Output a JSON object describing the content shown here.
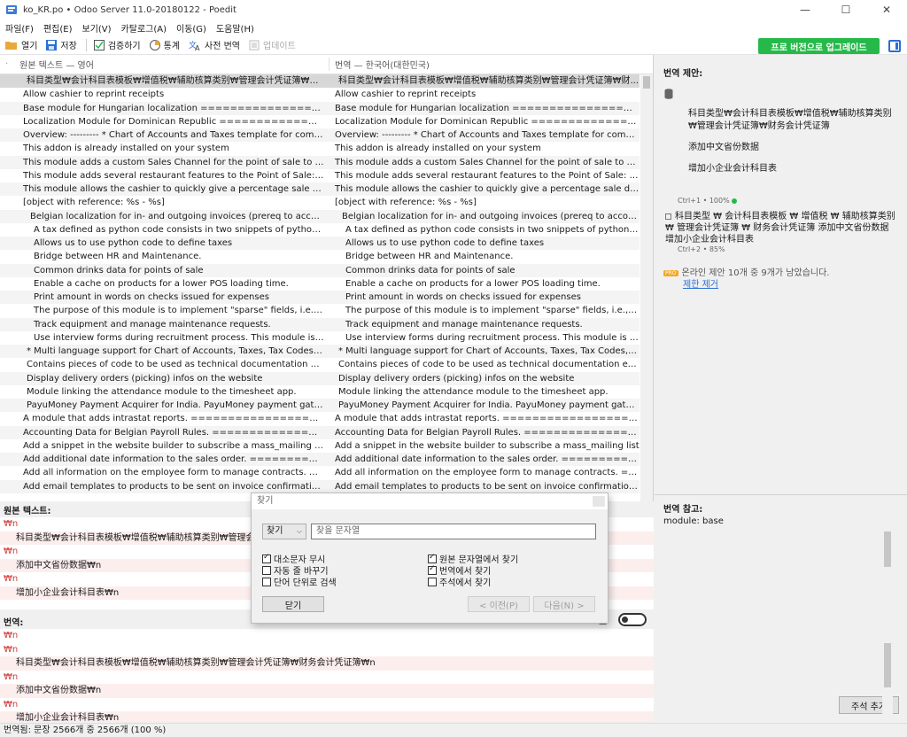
{
  "window": {
    "title": "ko_KR.po • Odoo Server 11.0-20180122 - Poedit",
    "minimize": "—",
    "maximize": "☐",
    "close": "✕"
  },
  "menu": [
    "파일(F)",
    "편집(E)",
    "보기(V)",
    "카탈로그(A)",
    "이동(G)",
    "도움말(H)"
  ],
  "toolbar": {
    "open": "열기",
    "save": "저장",
    "validate": "검증하기",
    "stats": "통계",
    "pretranslate": "사전 번역",
    "update": "업데이트",
    "upgrade": "프로 버전으로 업그레이드"
  },
  "list": {
    "source_header": "원본 텍스트 — 영어",
    "translation_header": "번역 — 한국어(대한민국)",
    "rows": [
      {
        "src": "科目类型₩会计科目表模板₩增值税₩辅助核算类别₩管理会计凭证簿₩财...",
        "trans": "科目类型₩会计科目表模板₩增值税₩辅助核算类别₩管理会计凭证簿₩财...",
        "indent": 1,
        "selected": true
      },
      {
        "src": "Allow cashier to reprint receipts",
        "trans": "Allow cashier to reprint receipts",
        "indent": 0
      },
      {
        "src": "Base module for Hungarian localization ========================...",
        "trans": "Base module for Hungarian localization ========================...",
        "indent": 0
      },
      {
        "src": "Localization Module for Dominican Republic ======================...",
        "trans": "Localization Module for Dominican Republic ======================...",
        "indent": 0
      },
      {
        "src": "Overview: ---------  * Chart of Accounts and Taxes template for companies i...",
        "trans": "Overview: ---------  * Chart of Accounts and Taxes template for companies i...",
        "indent": 0
      },
      {
        "src": "This addon is already installed on your system",
        "trans": "This addon is already installed on your system",
        "indent": 0
      },
      {
        "src": "This module adds a custom Sales Channel for the point of sale to be able to ...",
        "trans": "This module adds a custom Sales Channel for the point of sale to be able to ...",
        "indent": 0
      },
      {
        "src": "This module adds several restaurant features to the Point of Sale: - Bill Printi...",
        "trans": "This module adds several restaurant features to the Point of Sale: - Bill Printi...",
        "indent": 0
      },
      {
        "src": "This module allows the cashier to quickly give a percentage sale discount to ...",
        "trans": "This module allows the cashier to quickly give a percentage sale discount to ...",
        "indent": 0
      },
      {
        "src": "[object with reference: %s - %s]",
        "trans": "[object with reference: %s - %s]",
        "indent": 0
      },
      {
        "src": "Belgian localization for in- and outgoing invoices (prereq to account_coda...",
        "trans": "Belgian localization for in- and outgoing invoices (prereq to account_coda...",
        "indent": 2
      },
      {
        "src": "A tax defined as python code consists in two snippets of python code ...",
        "trans": "A tax defined as python code consists in two snippets of python code ...",
        "indent": 3
      },
      {
        "src": "Allows us to use python code to define taxes",
        "trans": "Allows us to use python code to define taxes",
        "indent": 3
      },
      {
        "src": "Bridge between HR and Maintenance.",
        "trans": "Bridge between HR and Maintenance.",
        "indent": 3
      },
      {
        "src": "Common drinks data for points of sale",
        "trans": "Common drinks data for points of sale",
        "indent": 3
      },
      {
        "src": "Enable a cache on products for a lower POS loading time.",
        "trans": "Enable a cache on products for a lower POS loading time.",
        "indent": 3
      },
      {
        "src": "Print amount in words on checks issued for expenses",
        "trans": "Print amount in words on checks issued for expenses",
        "indent": 3
      },
      {
        "src": "The purpose of this module is to implement \"sparse\" fields, i.e., fields ...",
        "trans": "The purpose of this module is to implement \"sparse\" fields, i.e., fields ...",
        "indent": 3
      },
      {
        "src": "Track equipment and manage maintenance requests.",
        "trans": "Track equipment and manage maintenance requests.",
        "indent": 3
      },
      {
        "src": "Use interview forms during recruitment process.          This module is in...",
        "trans": "Use interview forms during recruitment process.          This module is in...",
        "indent": 3
      },
      {
        "src": "* Multi language support for Chart of Accounts, Taxes, Tax Codes, Journals...",
        "trans": "* Multi language support for Chart of Accounts, Taxes, Tax Codes, Journals...",
        "indent": 1
      },
      {
        "src": "Contains pieces of code to be used as technical documentation examples ...",
        "trans": "Contains pieces of code to be used as technical documentation examples ...",
        "indent": 1
      },
      {
        "src": "Display delivery orders (picking) infos on the website",
        "trans": "Display delivery orders (picking) infos on the website",
        "indent": 1
      },
      {
        "src": "Module linking the attendance module to the timesheet app.",
        "trans": "Module linking the attendance module to the timesheet app.",
        "indent": 1
      },
      {
        "src": "PayuMoney Payment Acquirer for India.     PayuMoney payment gateway...",
        "trans": "PayuMoney Payment Acquirer for India.     PayuMoney payment gateway...",
        "indent": 1
      },
      {
        "src": "A module that adds intrastat reports. ===============================...",
        "trans": "A module that adds intrastat reports. ===============================...",
        "indent": 0
      },
      {
        "src": "Accounting Data for Belgian Payroll Rules. ==========================...",
        "trans": "Accounting Data for Belgian Payroll Rules. ==========================...",
        "indent": 0
      },
      {
        "src": "Add a snippet in the website builder to subscribe a mass_mailing list",
        "trans": "Add a snippet in the website builder to subscribe a mass_mailing list",
        "indent": 0
      },
      {
        "src": "Add additional date information to the sales order. ===================...",
        "trans": "Add additional date information to the sales order. ===================...",
        "indent": 0
      },
      {
        "src": "Add all information on the employee form to manage contracts. =========...",
        "trans": "Add all information on the employee form to manage contracts. =========...",
        "indent": 0
      },
      {
        "src": "Add email templates to products to be sent on invoice confirmation ======...",
        "trans": "Add email templates to products to be sent on invoice confirmation ======...",
        "indent": 0
      }
    ]
  },
  "side": {
    "suggestions_title": "번역 제안:",
    "suggestion1": [
      "科目类型₩会计科目表模板₩增值税₩辅助核算类别₩管理会计凭证簿₩财务会计凭证簿",
      "添加中文省份数据",
      "增加小企业会计科目表"
    ],
    "suggestion1_meta": "Ctrl+1 • 100%",
    "suggestion2": "科目类型 ₩ 会计科目表模板 ₩ 增值税 ₩ 辅助核算类别 ₩ 管理会计凭证簿 ₩ 财务会计凭证簿 添加中文省份数据 增加小企业会计科目表",
    "suggestion2_meta": "Ctrl+2 • 85%",
    "pro_badge": "PRO",
    "online_note": "온라인 제안 10개 중 9개가 남았습니다.",
    "remove_limit": "제한 제거",
    "notes_title": "번역 참고:",
    "notes_text": "module: base",
    "add_comment": "주석 추가"
  },
  "source_pane": {
    "title": "원본 텍스트:",
    "lines": [
      {
        "text": "₩n",
        "esc": true,
        "indent": false
      },
      {
        "text": "科目类型₩会计科目表模板₩增值税₩辅助核算类别₩管理会计凭证簿₩财务会计凭证簿",
        "esc": false,
        "indent": true
      },
      {
        "text": "₩n",
        "esc": true,
        "indent": false
      },
      {
        "text": "添加中文省份数据₩n",
        "esc": false,
        "indent": true
      },
      {
        "text": "₩n",
        "esc": true,
        "indent": false
      },
      {
        "text": "增加小企业会计科目表₩n",
        "esc": false,
        "indent": true
      }
    ]
  },
  "translation_pane": {
    "title": "번역:",
    "toggle_label": "표",
    "lines": [
      {
        "text": "₩n",
        "esc": true,
        "indent": false
      },
      {
        "text": "₩n",
        "esc": true,
        "indent": false
      },
      {
        "text": "科目类型₩会计科目表模板₩增值税₩辅助核算类别₩管理会计凭证簿₩财务会计凭证簿₩n",
        "esc": false,
        "indent": true
      },
      {
        "text": "₩n",
        "esc": true,
        "indent": false
      },
      {
        "text": "添加中文省份数据₩n",
        "esc": false,
        "indent": true
      },
      {
        "text": "₩n",
        "esc": true,
        "indent": false
      },
      {
        "text": "增加小企业会计科目表₩n",
        "esc": false,
        "indent": true
      }
    ]
  },
  "find_dialog": {
    "title": "찾기",
    "mode": "찾기",
    "placeholder": "찾을 문자열",
    "options_left": [
      {
        "label": "대소문자 무시",
        "checked": true
      },
      {
        "label": "자동 줄 바꾸기",
        "checked": false
      },
      {
        "label": "단어 단위로 검색",
        "checked": false
      }
    ],
    "options_right": [
      {
        "label": "원본 문자열에서 찾기",
        "checked": true
      },
      {
        "label": "번역에서 찾기",
        "checked": true
      },
      {
        "label": "주석에서 찾기",
        "checked": false
      }
    ],
    "close": "닫기",
    "prev": "< 이전(P)",
    "next": "다음(N) >"
  },
  "status": "번역됨: 문장 2566개 중 2566개 (100 %)",
  "colors": {
    "accent_green": "#26b94a",
    "link_blue": "#2a6fd6",
    "escape_red": "#d13b3b"
  }
}
